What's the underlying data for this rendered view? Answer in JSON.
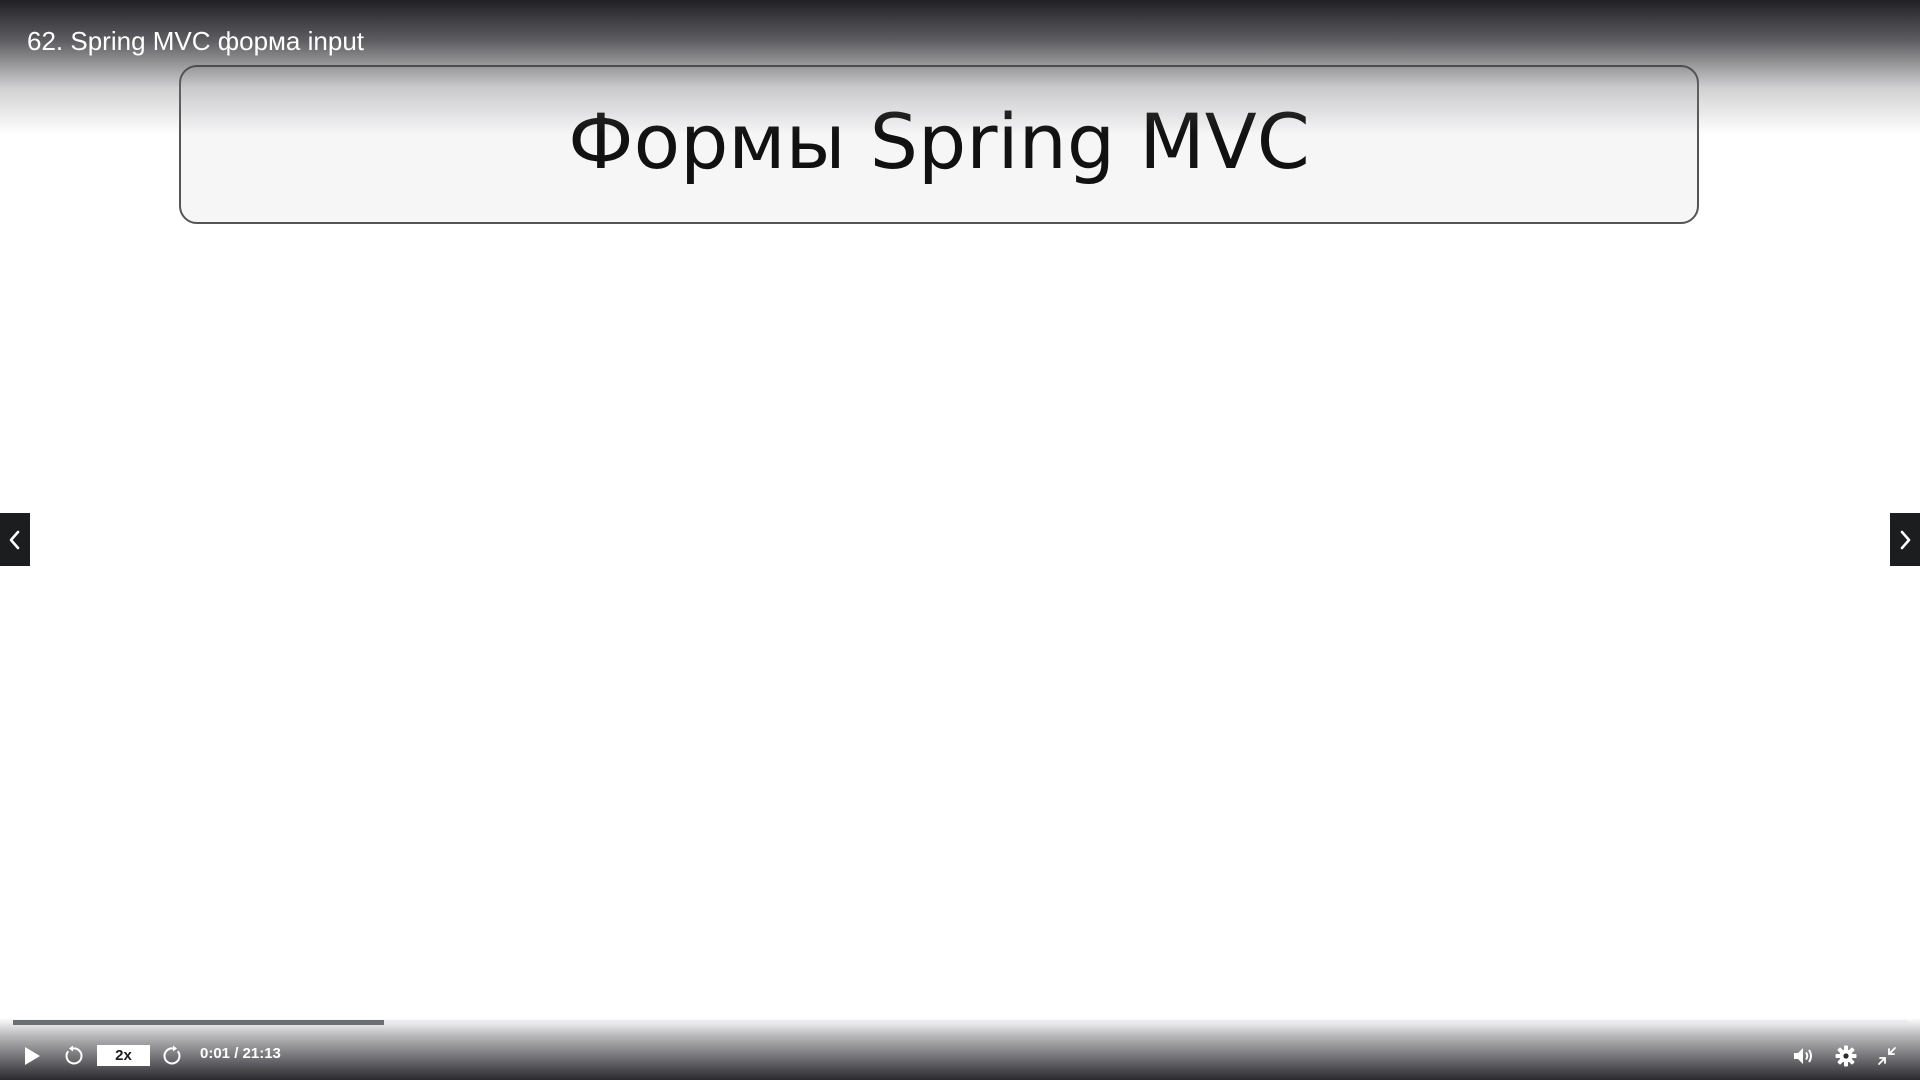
{
  "header": {
    "video_title": "62. Spring MVC форма input"
  },
  "slide": {
    "title": "Формы Spring MVC"
  },
  "player": {
    "progress_fraction": 0.196,
    "speed_label": "2x",
    "time_label": "0:01 / 21:13",
    "colors": {
      "progress_fill": "#6a6f73",
      "nav_bg": "#1c1d1f"
    },
    "icons": {
      "prev": "chevron-left-icon",
      "next": "chevron-right-icon",
      "play": "play-icon",
      "rewind": "rewind-icon",
      "forward": "forward-icon",
      "volume": "volume-icon",
      "settings": "gear-icon",
      "exit_fullscreen": "exit-fullscreen-icon"
    }
  }
}
